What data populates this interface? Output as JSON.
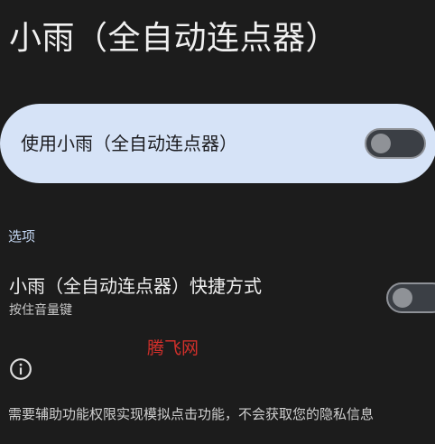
{
  "header": {
    "title": "小雨（全自动连点器）"
  },
  "main_toggle": {
    "label": "使用小雨（全自动连点器）",
    "enabled": false
  },
  "options_section": {
    "header": "选项",
    "shortcut": {
      "title": "小雨（全自动连点器）快捷方式",
      "subtitle": "按住音量键",
      "enabled": false
    }
  },
  "watermark": {
    "text": "腾飞网"
  },
  "footer": {
    "info_icon": "info-icon",
    "description": "需要辅助功能权限实现模拟点击功能，不会获取您的隐私信息"
  },
  "colors": {
    "background": "#1c1c1c",
    "card": "#d6e3f7",
    "section_header": "#c3d6f2",
    "watermark": "#d2302b",
    "switch_track": "#3b3f45",
    "switch_thumb": "#8f9297"
  }
}
